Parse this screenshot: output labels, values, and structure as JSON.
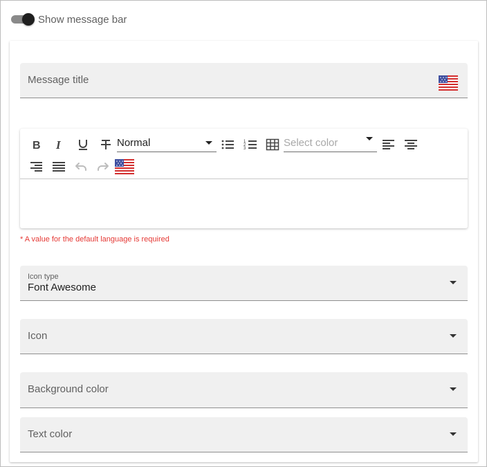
{
  "toggle": {
    "label": "Show message bar",
    "checked": true
  },
  "message_title": {
    "placeholder": "Message title"
  },
  "editor": {
    "format_select": {
      "value": "Normal"
    },
    "color_select": {
      "placeholder": "Select color"
    },
    "error_text": "* A value for the default language is required"
  },
  "icon_type": {
    "label": "Icon type",
    "value": "Font Awesome"
  },
  "icon": {
    "placeholder": "Icon"
  },
  "background_color": {
    "placeholder": "Background color"
  },
  "text_color": {
    "placeholder": "Text color"
  },
  "colors": {
    "error": "#e53935",
    "field_bg": "#f0f0f0",
    "toggle_thumb": "#1f1f1f"
  },
  "icons": [
    "us-flag-icon",
    "bold-icon",
    "italic-icon",
    "underline-icon",
    "strikethrough-icon",
    "bullet-list-icon",
    "numbered-list-icon",
    "table-icon",
    "align-left-icon",
    "align-center-icon",
    "align-right-icon",
    "align-justify-icon",
    "undo-icon",
    "redo-icon",
    "chevron-down-icon"
  ]
}
